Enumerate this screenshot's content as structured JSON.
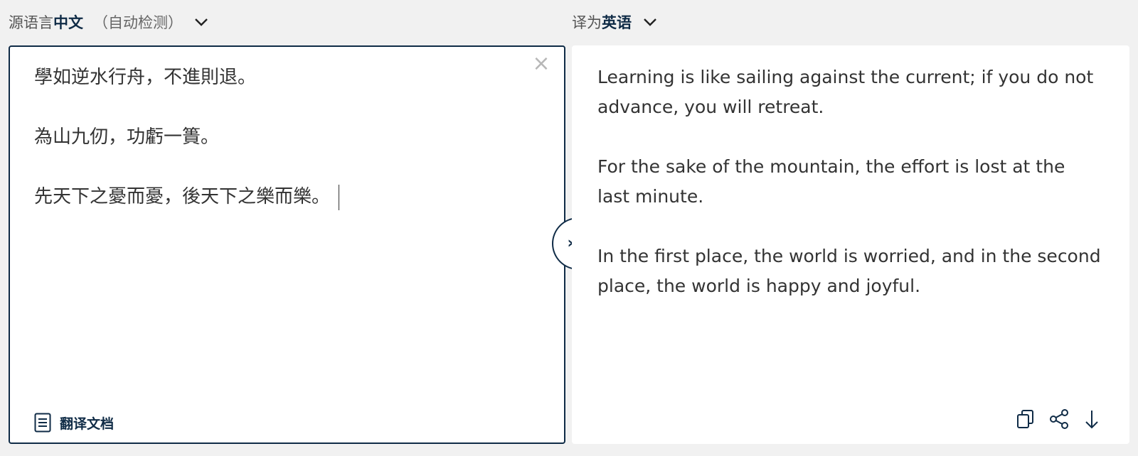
{
  "source_lang_bar": {
    "prefix": "源语言",
    "language": "中文",
    "auto_detect": "（自动检测）",
    "dropdown_icon": "chevron-down-icon"
  },
  "target_lang_bar": {
    "prefix": "译为",
    "language": "英语",
    "dropdown_icon": "chevron-down-icon"
  },
  "source_panel": {
    "paragraphs": [
      "學如逆水行舟，不進則退。",
      "為山九仞，功虧一簣。",
      "先天下之憂而憂，後天下之樂而樂。"
    ],
    "clear_icon": "close-icon",
    "clear_glyph": "×",
    "translate_document_label": "翻译文档",
    "document_icon": "document-icon"
  },
  "swap": {
    "icon": "chevron-right-icon",
    "glyph": "›"
  },
  "target_panel": {
    "paragraphs": [
      "Learning is like sailing against the current; if you do not advance, you will retreat.",
      "For the sake of the mountain, the effort is lost at the last minute.",
      "In the first place, the world is worried, and in the second place, the world is happy and joyful."
    ],
    "actions": [
      "copy-icon",
      "share-icon",
      "download-icon"
    ]
  },
  "colors": {
    "accent": "#0f2b46",
    "background": "#f1f1f1",
    "panel": "#ffffff",
    "text": "#333333",
    "muted": "#b7b7b7"
  }
}
